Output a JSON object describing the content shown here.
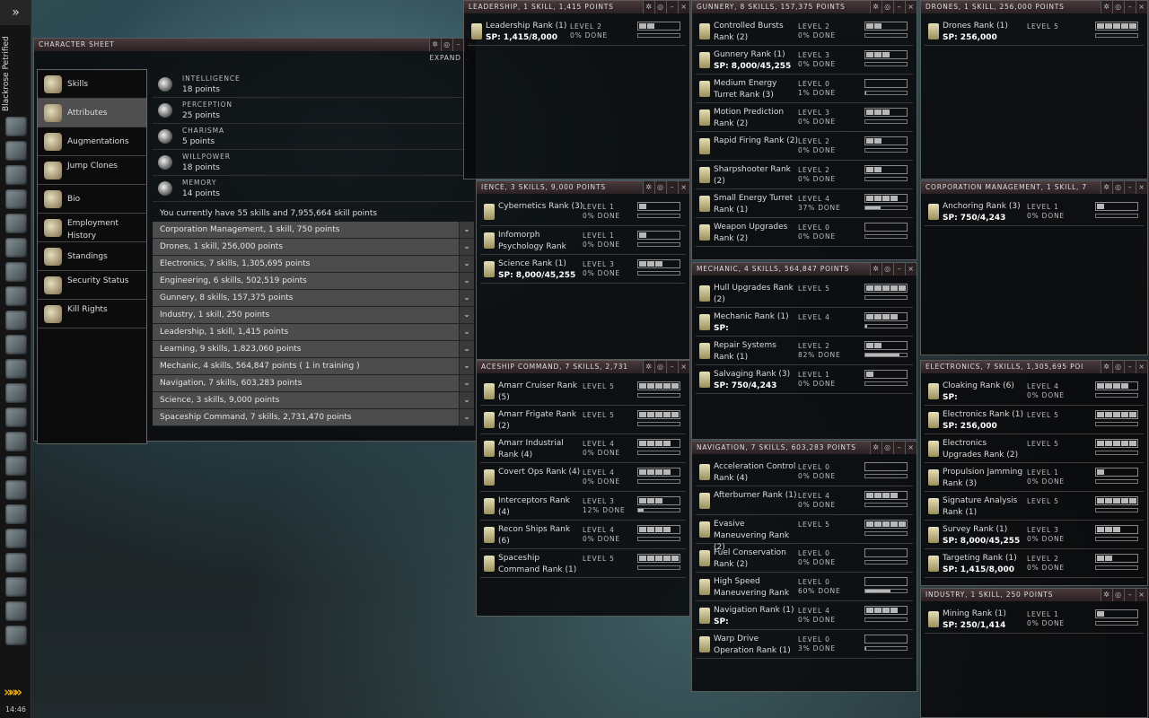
{
  "sidebar": {
    "pilot_name": "Blackrose Petrified",
    "clock": "14:46",
    "menu_glyph": "»",
    "collapse_glyph": "»»»"
  },
  "character_sheet": {
    "title": "CHARACTER SHEET",
    "expand_label": "EXPAND",
    "nav": [
      {
        "label": "Skills",
        "icon": "skills-icon",
        "active": false
      },
      {
        "label": "Attributes",
        "icon": "attributes-icon",
        "active": true
      },
      {
        "label": "Augmentations",
        "icon": "augmentations-icon",
        "active": false
      },
      {
        "label": "Jump Clones",
        "icon": "jump-clones-icon",
        "active": false
      },
      {
        "label": "Bio",
        "icon": "bio-icon",
        "active": false
      },
      {
        "label": "Employment History",
        "icon": "employment-icon",
        "active": false
      },
      {
        "label": "Standings",
        "icon": "standings-icon",
        "active": false
      },
      {
        "label": "Security Status",
        "icon": "security-icon",
        "active": false
      },
      {
        "label": "Kill Rights",
        "icon": "kill-rights-icon",
        "active": false
      }
    ],
    "attributes": [
      {
        "name": "INTELLIGENCE",
        "value": "18 points"
      },
      {
        "name": "PERCEPTION",
        "value": "25 points"
      },
      {
        "name": "CHARISMA",
        "value": "5 points"
      },
      {
        "name": "WILLPOWER",
        "value": "18 points"
      },
      {
        "name": "MEMORY",
        "value": "14 points"
      }
    ],
    "summary": "You currently have 55 skills and 7,955,664 skill points",
    "groups": [
      "Corporation Management, 1 skill, 750 points",
      "Drones, 1 skill, 256,000 points",
      "Electronics, 7 skills, 1,305,695 points",
      "Engineering, 6 skills, 502,519 points",
      "Gunnery, 8 skills, 157,375 points",
      "Industry, 1 skill, 250 points",
      "Leadership, 1 skill, 1,415 points",
      "Learning, 9 skills, 1,823,060 points",
      "Mechanic, 4 skills, 564,847 points ( 1 in training )",
      "Navigation, 7 skills, 603,283 points",
      "Science, 3 skills, 9,000 points",
      "Spaceship Command, 7 skills, 2,731,470 points"
    ]
  },
  "panels": [
    {
      "title": "LEADERSHIP, 1 SKILL, 1,415 POINTS",
      "skills": [
        {
          "name": "Leadership Rank (1)",
          "sp": "SP: 1,415/8,000",
          "level": "LEVEL 2",
          "done": "0% DONE",
          "lv": 2,
          "train": 0
        }
      ]
    },
    {
      "title": "IENCE, 3 SKILLS, 9,000 POINTS",
      "skills": [
        {
          "name": "Cybernetics Rank (3)",
          "sp": "",
          "level": "LEVEL 1",
          "done": "0% DONE",
          "lv": 1,
          "train": 0
        },
        {
          "name": "Infomorph Psychology Rank",
          "sp": "",
          "level": "LEVEL 1",
          "done": "0% DONE",
          "lv": 1,
          "train": 0
        },
        {
          "name": "Science Rank (1)",
          "sp": "SP: 8,000/45,255",
          "level": "LEVEL 3",
          "done": "0% DONE",
          "lv": 3,
          "train": 0
        }
      ]
    },
    {
      "title": "ACESHIP COMMAND, 7 SKILLS, 2,731",
      "skills": [
        {
          "name": "Amarr Cruiser Rank (5)",
          "sp": "",
          "level": "LEVEL 5",
          "done": "",
          "lv": 5,
          "train": 0
        },
        {
          "name": "Amarr Frigate Rank (2)",
          "sp": "",
          "level": "LEVEL 5",
          "done": "",
          "lv": 5,
          "train": 0
        },
        {
          "name": "Amarr Industrial Rank (4)",
          "sp": "",
          "level": "LEVEL 4",
          "done": "0% DONE",
          "lv": 4,
          "train": 0
        },
        {
          "name": "Covert Ops Rank (4)",
          "sp": "",
          "level": "LEVEL 4",
          "done": "0% DONE",
          "lv": 4,
          "train": 0
        },
        {
          "name": "Interceptors Rank (4)",
          "sp": "",
          "level": "LEVEL 3",
          "done": "12% DONE",
          "lv": 3,
          "train": 12
        },
        {
          "name": "Recon Ships Rank (6)",
          "sp": "",
          "level": "LEVEL 4",
          "done": "0% DONE",
          "lv": 4,
          "train": 0
        },
        {
          "name": "Spaceship Command Rank (1)",
          "sp": "",
          "level": "LEVEL 5",
          "done": "",
          "lv": 5,
          "train": 0
        }
      ]
    },
    {
      "title": "GUNNERY, 8 SKILLS, 157,375 POINTS",
      "skills": [
        {
          "name": "Controlled Bursts Rank (2)",
          "sp": "",
          "level": "LEVEL 2",
          "done": "0% DONE",
          "lv": 2,
          "train": 0
        },
        {
          "name": "Gunnery Rank (1)",
          "sp": "SP: 8,000/45,255",
          "level": "LEVEL 3",
          "done": "0% DONE",
          "lv": 3,
          "train": 0
        },
        {
          "name": "Medium Energy Turret Rank (3)",
          "sp": "",
          "level": "LEVEL 0",
          "done": "1% DONE",
          "lv": 0,
          "train": 1
        },
        {
          "name": "Motion Prediction Rank (2)",
          "sp": "",
          "level": "LEVEL 3",
          "done": "0% DONE",
          "lv": 3,
          "train": 0
        },
        {
          "name": "Rapid Firing Rank (2)",
          "sp": "",
          "level": "LEVEL 2",
          "done": "0% DONE",
          "lv": 2,
          "train": 0
        },
        {
          "name": "Sharpshooter Rank (2)",
          "sp": "",
          "level": "LEVEL 2",
          "done": "0% DONE",
          "lv": 2,
          "train": 0
        },
        {
          "name": "Small Energy Turret Rank (1)",
          "sp": "",
          "level": "LEVEL 4",
          "done": "37% DONE",
          "lv": 4,
          "train": 37
        },
        {
          "name": "Weapon Upgrades Rank (2)",
          "sp": "",
          "level": "LEVEL 0",
          "done": "0% DONE",
          "lv": 0,
          "train": 0
        }
      ]
    },
    {
      "title": "MECHANIC, 4 SKILLS, 564,847 POINTS",
      "skills": [
        {
          "name": "Hull Upgrades Rank (2)",
          "sp": "",
          "level": "LEVEL 5",
          "done": "",
          "lv": 5,
          "train": 0
        },
        {
          "name": "Mechanic Rank (1)",
          "sp": "SP:",
          "level": "LEVEL 4",
          "done": "",
          "lv": 4,
          "train": 5
        },
        {
          "name": "Repair Systems Rank (1)",
          "sp": "",
          "level": "LEVEL 2",
          "done": "82% DONE",
          "lv": 2,
          "train": 82
        },
        {
          "name": "Salvaging Rank (3)",
          "sp": "SP: 750/4,243",
          "level": "LEVEL 1",
          "done": "0% DONE",
          "lv": 1,
          "train": 0
        }
      ]
    },
    {
      "title": "NAVIGATION, 7 SKILLS, 603,283 POINTS",
      "skills": [
        {
          "name": "Acceleration Control Rank (4)",
          "sp": "",
          "level": "LEVEL 0",
          "done": "0% DONE",
          "lv": 0,
          "train": 0
        },
        {
          "name": "Afterburner Rank (1)",
          "sp": "",
          "level": "LEVEL 4",
          "done": "0% DONE",
          "lv": 4,
          "train": 0
        },
        {
          "name": "Evasive Maneuvering Rank (2)",
          "sp": "",
          "level": "LEVEL 5",
          "done": "",
          "lv": 5,
          "train": 0
        },
        {
          "name": "Fuel Conservation Rank (2)",
          "sp": "",
          "level": "LEVEL 0",
          "done": "0% DONE",
          "lv": 0,
          "train": 0
        },
        {
          "name": "High Speed Maneuvering Rank",
          "sp": "",
          "level": "LEVEL 0",
          "done": "60% DONE",
          "lv": 0,
          "train": 60
        },
        {
          "name": "Navigation Rank (1)",
          "sp": "SP:",
          "level": "LEVEL 4",
          "done": "0% DONE",
          "lv": 4,
          "train": 0
        },
        {
          "name": "Warp Drive Operation Rank (1)",
          "sp": "",
          "level": "LEVEL 0",
          "done": "3% DONE",
          "lv": 0,
          "train": 3
        }
      ]
    },
    {
      "title": "DRONES, 1 SKILL, 256,000 POINTS",
      "skills": [
        {
          "name": "Drones Rank (1)",
          "sp": "SP: 256,000",
          "level": "LEVEL 5",
          "done": "",
          "lv": 5,
          "train": 0
        }
      ]
    },
    {
      "title": "CORPORATION MANAGEMENT, 1 SKILL, 7",
      "skills": [
        {
          "name": "Anchoring Rank (3)",
          "sp": "SP: 750/4,243",
          "level": "LEVEL 1",
          "done": "0% DONE",
          "lv": 1,
          "train": 0
        }
      ]
    },
    {
      "title": "ELECTRONICS, 7 SKILLS, 1,305,695 POI",
      "skills": [
        {
          "name": "Cloaking Rank (6)",
          "sp": "SP:",
          "level": "LEVEL 4",
          "done": "0% DONE",
          "lv": 4,
          "train": 0
        },
        {
          "name": "Electronics Rank (1)",
          "sp": "SP: 256,000",
          "level": "LEVEL 5",
          "done": "",
          "lv": 5,
          "train": 0
        },
        {
          "name": "Electronics Upgrades Rank (2)",
          "sp": "",
          "level": "LEVEL 5",
          "done": "",
          "lv": 5,
          "train": 0
        },
        {
          "name": "Propulsion Jamming Rank (3)",
          "sp": "",
          "level": "LEVEL 1",
          "done": "0% DONE",
          "lv": 1,
          "train": 0
        },
        {
          "name": "Signature Analysis Rank (1)",
          "sp": "",
          "level": "LEVEL 5",
          "done": "",
          "lv": 5,
          "train": 0
        },
        {
          "name": "Survey Rank (1)",
          "sp": "SP: 8,000/45,255",
          "level": "LEVEL 3",
          "done": "0% DONE",
          "lv": 3,
          "train": 0
        },
        {
          "name": "Targeting Rank (1)",
          "sp": "SP: 1,415/8,000",
          "level": "LEVEL 2",
          "done": "0% DONE",
          "lv": 2,
          "train": 0
        }
      ]
    },
    {
      "title": "INDUSTRY, 1 SKILL, 250 POINTS",
      "skills": [
        {
          "name": "Mining Rank (1)",
          "sp": "SP: 250/1,414",
          "level": "LEVEL 1",
          "done": "0% DONE",
          "lv": 1,
          "train": 0
        }
      ]
    }
  ]
}
